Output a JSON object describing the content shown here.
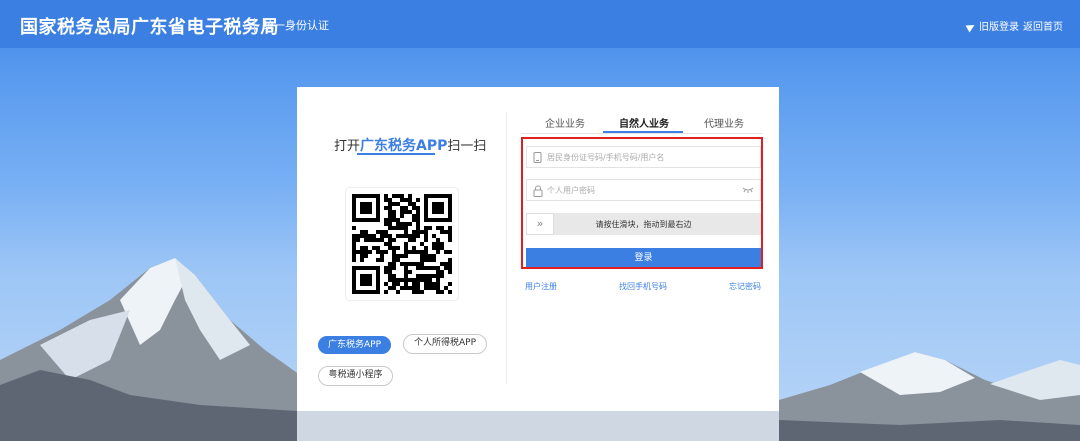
{
  "header": {
    "title": "国家税务总局广东省电子税务局",
    "subtitle": "统一身份认证",
    "old_login": "旧版登录",
    "back_home": "返回首页"
  },
  "qr": {
    "prefix": "打开",
    "app_name": "广东税务APP",
    "suffix": "扫一扫"
  },
  "app_pills": [
    {
      "label": "广东税务APP",
      "active": true
    },
    {
      "label": "个人所得税APP",
      "active": false
    },
    {
      "label": "粤税通小程序",
      "active": false
    }
  ],
  "tabs": [
    {
      "label": "企业业务",
      "active": false
    },
    {
      "label": "自然人业务",
      "active": true
    },
    {
      "label": "代理业务",
      "active": false
    }
  ],
  "form": {
    "username_placeholder": "居民身份证号码/手机号码/用户名",
    "password_placeholder": "个人用户密码",
    "slider_text": "请按住滑块，拖动到最右边",
    "login_label": "登录"
  },
  "links": {
    "register": "用户注册",
    "retrieve_phone": "找回手机号码",
    "forgot_password": "忘记密码"
  },
  "colors": {
    "accent": "#3b7fe3",
    "highlight_box": "#e02020"
  }
}
